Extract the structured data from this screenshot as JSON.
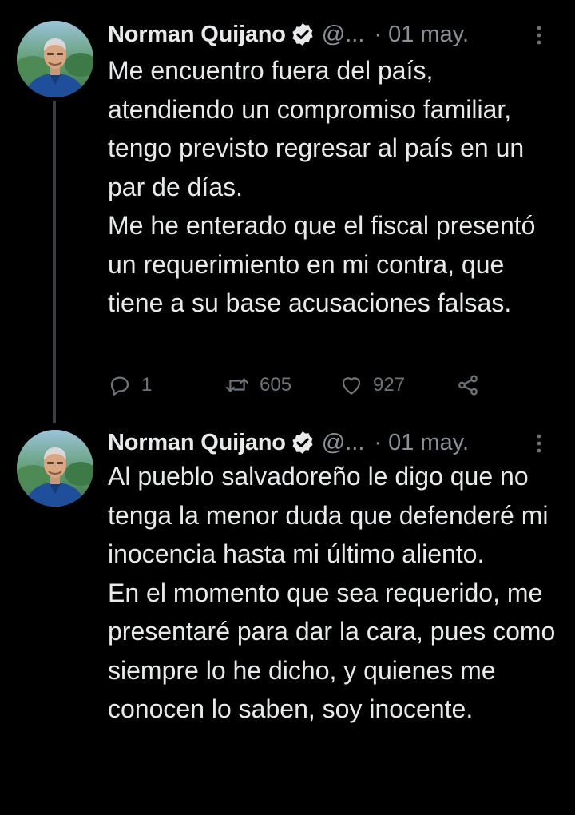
{
  "colors": {
    "background": "#000000",
    "text_primary": "#e7e9ea",
    "text_secondary": "#8b9096",
    "action_gray": "#6e7378",
    "verified_badge": "#e7e9ea",
    "thread_line": "#3b3f43"
  },
  "tweets": [
    {
      "author": {
        "name": "Norman Quijano",
        "handle": "@...",
        "verified": true,
        "verified_icon": "verified-badge-icon",
        "avatar_icon": "avatar-photo"
      },
      "separator": "·",
      "date": "01 may.",
      "more_icon": "more-vertical-icon",
      "paragraphs": [
        "Me encuentro fuera del país, atendiendo un compromiso familiar, tengo previsto regresar al país en un par de días.",
        "Me he enterado que el fiscal presentó un requerimiento en mi contra, que tiene a su base acusaciones falsas."
      ],
      "actions": {
        "reply": {
          "icon": "reply-icon",
          "count": "1"
        },
        "retweet": {
          "icon": "retweet-icon",
          "count": "605"
        },
        "like": {
          "icon": "heart-icon",
          "count": "927"
        },
        "share": {
          "icon": "share-icon"
        }
      }
    },
    {
      "author": {
        "name": "Norman Quijano",
        "handle": "@...",
        "verified": true,
        "verified_icon": "verified-badge-icon",
        "avatar_icon": "avatar-photo"
      },
      "separator": "·",
      "date": "01 may.",
      "more_icon": "more-vertical-icon",
      "paragraphs": [
        "Al pueblo salvadoreño le digo que no tenga la menor duda que defenderé mi inocencia hasta mi último aliento.",
        "En el momento que sea requerido, me presentaré para dar la cara, pues como siempre lo he dicho, y quienes me conocen lo saben, soy inocente."
      ]
    }
  ]
}
